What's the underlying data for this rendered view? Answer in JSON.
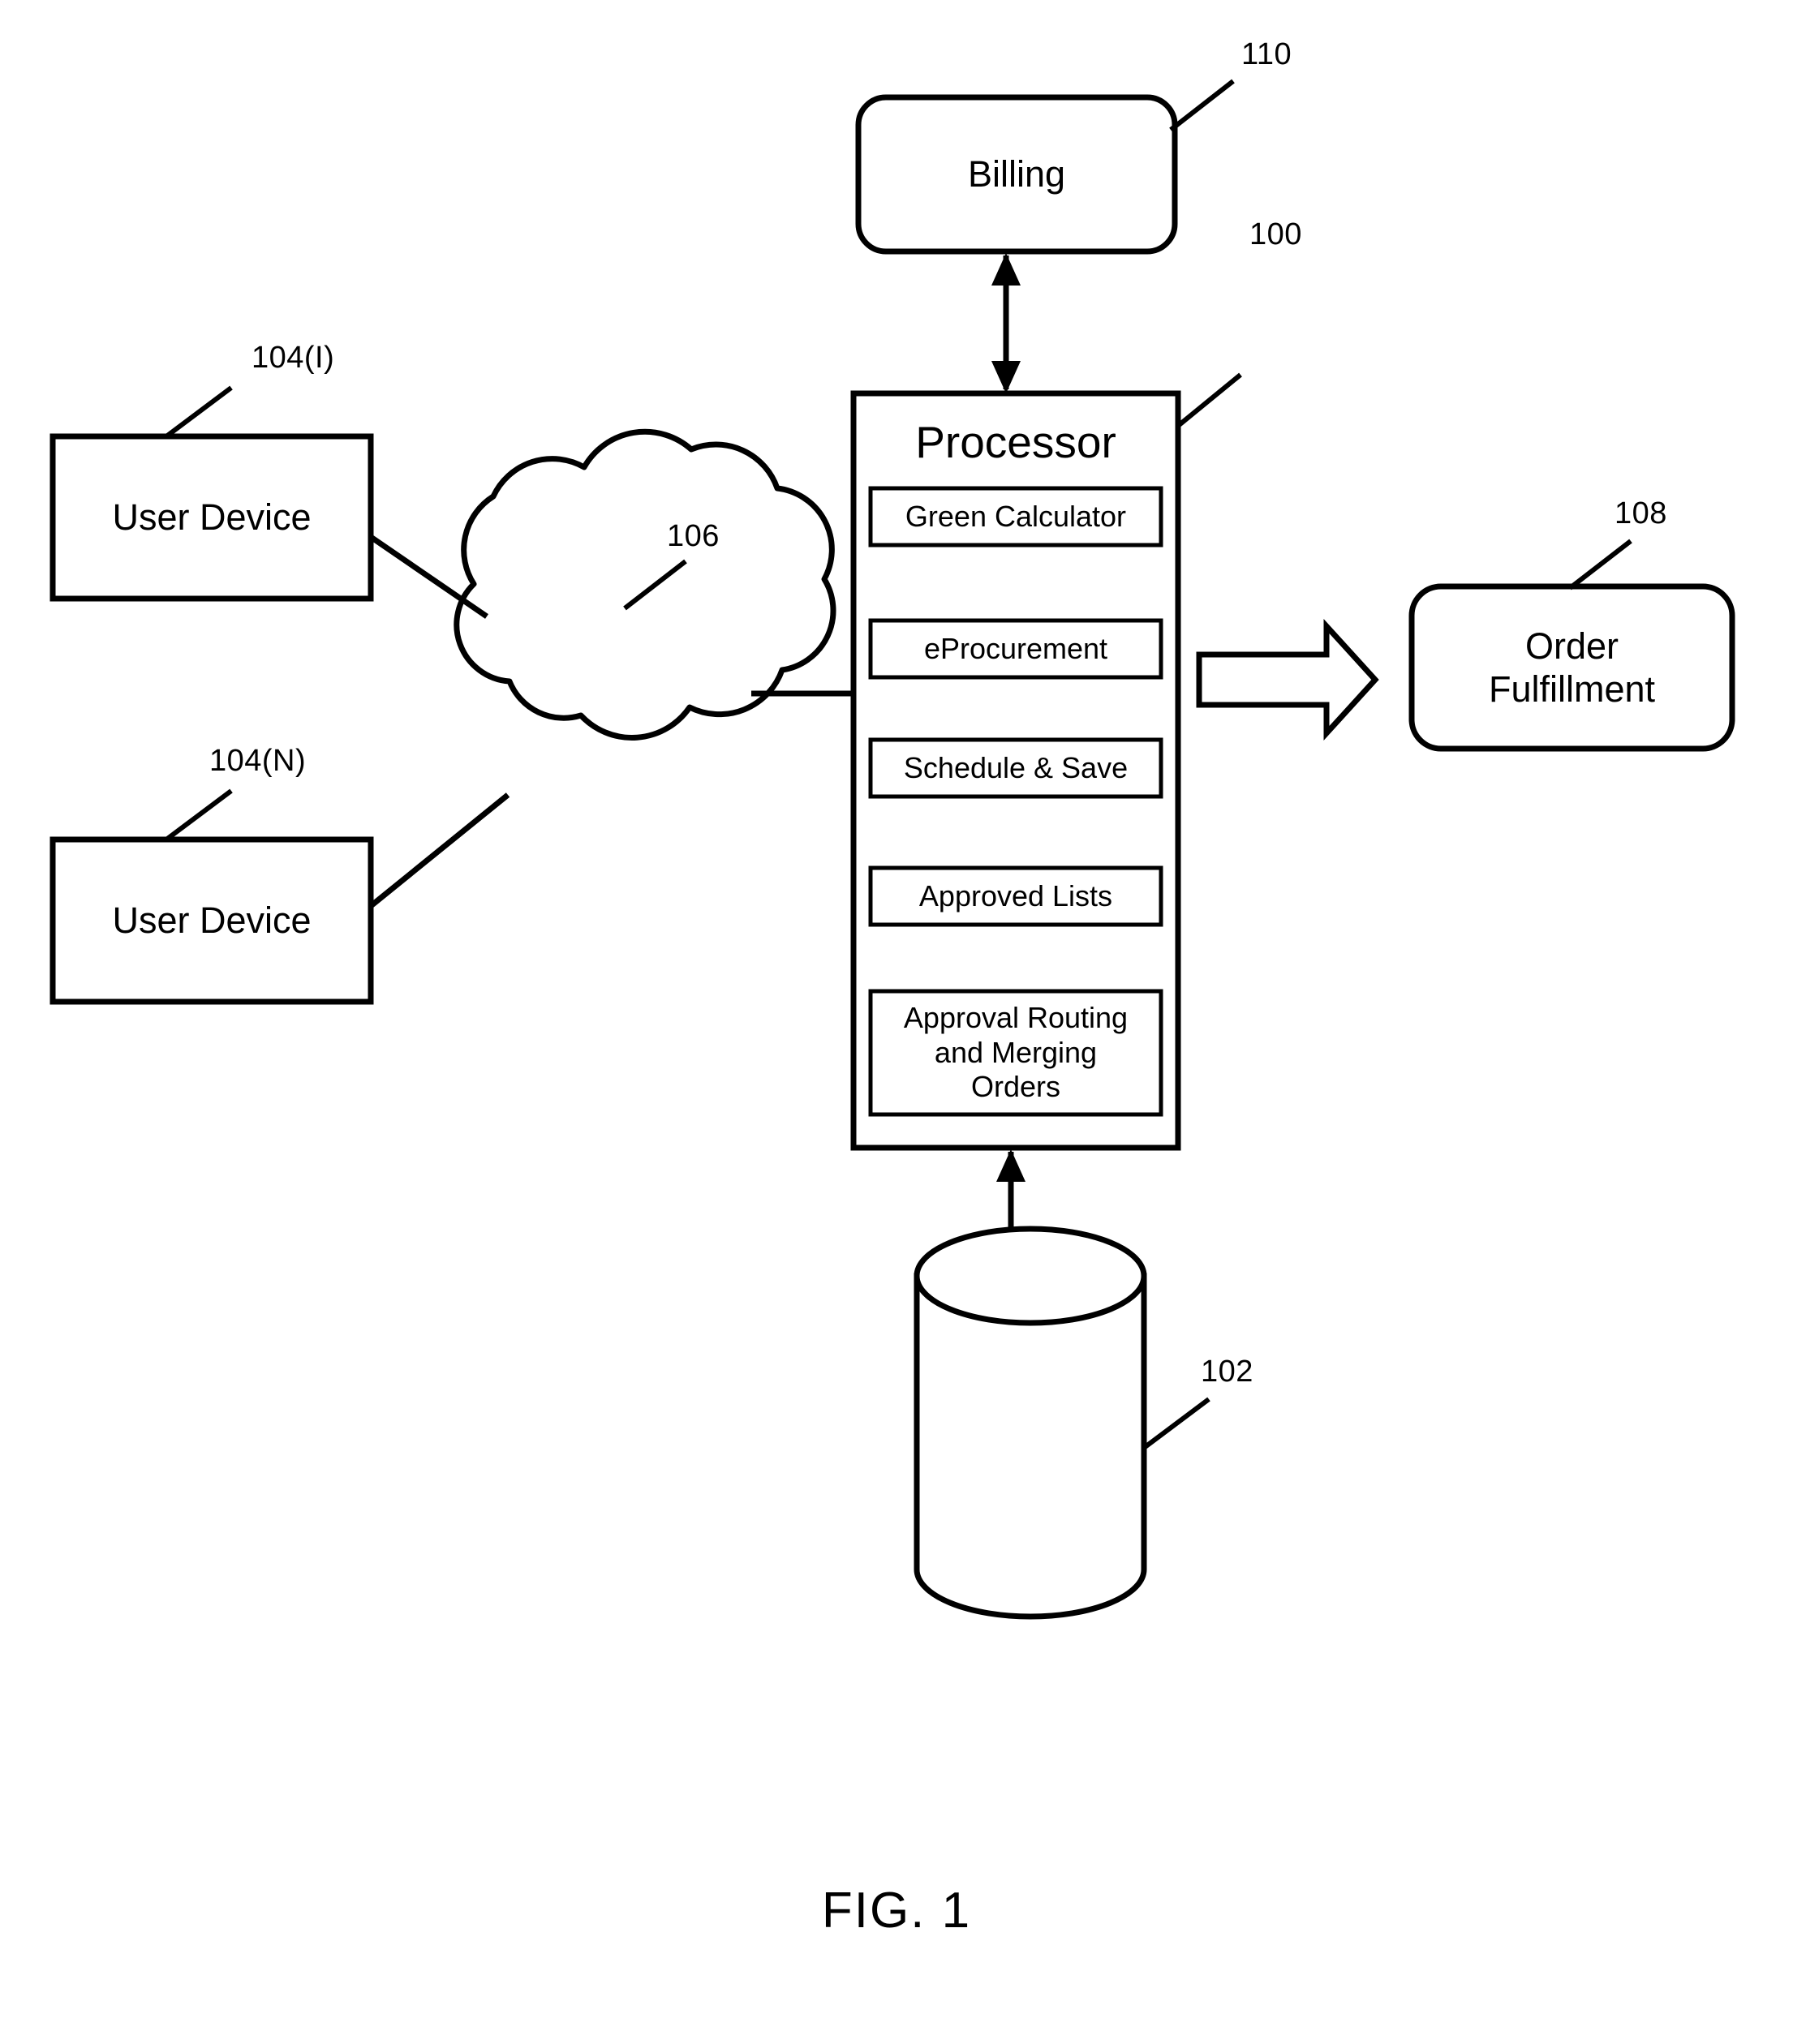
{
  "figure": {
    "caption": "FIG. 1"
  },
  "nodes": {
    "billing": {
      "label": "Billing",
      "ref": "110"
    },
    "processor": {
      "label": "Processor",
      "ref": "100",
      "modules": [
        {
          "label": "Green Calculator"
        },
        {
          "label": "eProcurement"
        },
        {
          "label": "Schedule & Save"
        },
        {
          "label": "Approved Lists"
        },
        {
          "label": "Approval Routing\nand Merging\nOrders"
        }
      ]
    },
    "user_device_1": {
      "label": "User Device",
      "ref": "104(I)"
    },
    "user_device_n": {
      "label": "User Device",
      "ref": "104(N)"
    },
    "network": {
      "label": "",
      "ref": "106",
      "icon": "cloud-icon"
    },
    "database": {
      "label": "",
      "ref": "102",
      "icon": "cylinder-database-icon"
    },
    "order_fulfillment": {
      "label": "Order\nFulfillment",
      "ref": "108"
    }
  },
  "colors": {
    "line": "#000000",
    "background": "#ffffff"
  }
}
